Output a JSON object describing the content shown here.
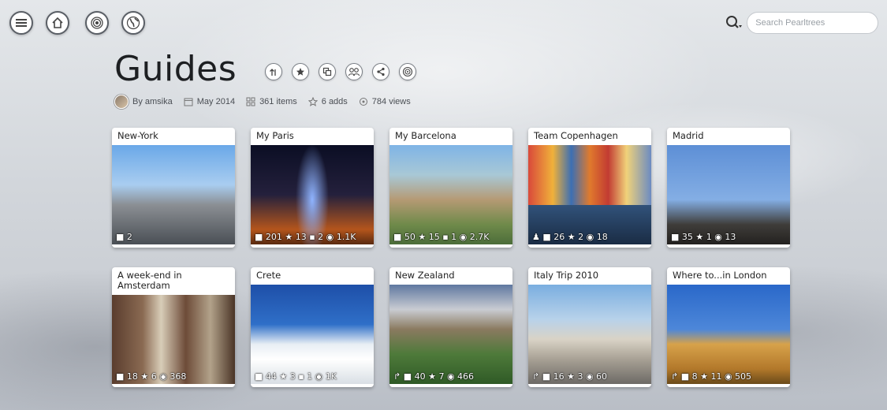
{
  "nav": {
    "menu_icon": "hamburger-icon",
    "home_icon": "home-icon",
    "radar_icon": "radar-icon",
    "globe_icon": "globe-icon"
  },
  "search": {
    "placeholder": "Search Pearltrees"
  },
  "page": {
    "title": "Guides"
  },
  "actions": [
    {
      "icon": "upload-icon"
    },
    {
      "icon": "star-icon"
    },
    {
      "icon": "copy-icon"
    },
    {
      "icon": "team-icon"
    },
    {
      "icon": "share-icon"
    },
    {
      "icon": "target-icon"
    }
  ],
  "meta": {
    "author": "By amsika",
    "date": "May 2014",
    "items": "361 items",
    "adds": "6 adds",
    "views": "784 views"
  },
  "cards": [
    {
      "title": "New-York",
      "stats": "■ 2"
    },
    {
      "title": "My Paris",
      "stats": "■ 201 ★ 13 ▪ 2 ◉ 1.1K"
    },
    {
      "title": "My Barcelona",
      "stats": "■ 50 ★ 15 ▪ 1 ◉ 2.7K"
    },
    {
      "title": "Team Copenhagen",
      "stats": "♟ ■ 26 ★ 2 ◉ 18"
    },
    {
      "title": "Madrid",
      "stats": "■ 35 ★ 1 ◉ 13"
    },
    {
      "title": "A week-end in Amsterdam",
      "stats": "■ 18 ★ 6 ◉ 368"
    },
    {
      "title": "Crete",
      "stats": "■ 44 ★ 3 ▪ 1 ◉ 1K"
    },
    {
      "title": "New Zealand",
      "stats": "↱ ■ 40 ★ 7 ◉ 466"
    },
    {
      "title": "Italy Trip 2010",
      "stats": "↱ ■ 16 ★ 3 ◉ 60"
    },
    {
      "title": "Where to...in London",
      "stats": "↱ ■ 8 ★ 11 ◉ 505"
    }
  ]
}
